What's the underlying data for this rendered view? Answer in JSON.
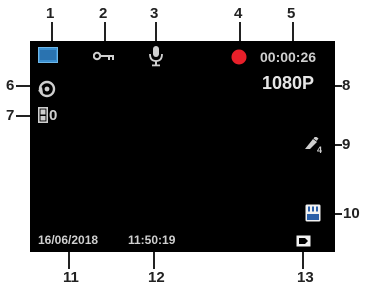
{
  "callouts": [
    "1",
    "2",
    "3",
    "4",
    "5",
    "6",
    "7",
    "8",
    "9",
    "10",
    "11",
    "12",
    "13"
  ],
  "screen": {
    "timer": "00:00:26",
    "resolution": "1080P",
    "exposure_value": "0",
    "wb_value": "4",
    "date": "16/06/2018",
    "time": "11:50:19"
  },
  "icons": {
    "mode": "video-mode-icon",
    "lock": "key-lock-icon",
    "mic": "microphone-icon",
    "record": "record-dot-icon",
    "loop": "loop-recording-icon",
    "exposure": "exposure-icon",
    "white_balance": "white-balance-icon",
    "sd_card": "sd-card-icon",
    "battery": "battery-icon"
  },
  "colors": {
    "screen_bg": "#000000",
    "record": "#e8202a",
    "mode_icon": "#3a8fd0",
    "text": "#cfcfcf"
  }
}
